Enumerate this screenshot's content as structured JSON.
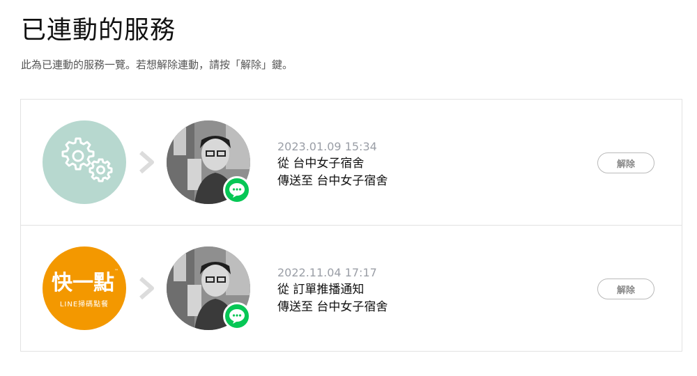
{
  "header": {
    "title": "已連動的服務",
    "description": "此為已連動的服務一覽。若想解除連動，請按「解除」鍵。"
  },
  "services": [
    {
      "icon": "gears-icon",
      "icon_bg": "#b7d8cf",
      "timestamp": "2023.01.09 15:34",
      "from_prefix": "從",
      "from_name": "台中女子宿舍",
      "to_prefix": "傳送至",
      "to_name": "台中女子宿舍",
      "unlink_label": "解除"
    },
    {
      "icon": "brand-logo",
      "icon_bg": "#f39800",
      "brand_name": "快一點",
      "brand_sub": "LINE掃碼點餐",
      "timestamp": "2022.11.04 17:17",
      "from_prefix": "從",
      "from_name": "訂單推播通知",
      "to_prefix": "傳送至",
      "to_name": "台中女子宿舍",
      "unlink_label": "解除"
    }
  ],
  "colors": {
    "line_green": "#06c755",
    "gear_bg": "#b7d8cf",
    "brand_orange": "#f39800",
    "border": "#e2e2e2",
    "timestamp": "#9a9ea6"
  }
}
